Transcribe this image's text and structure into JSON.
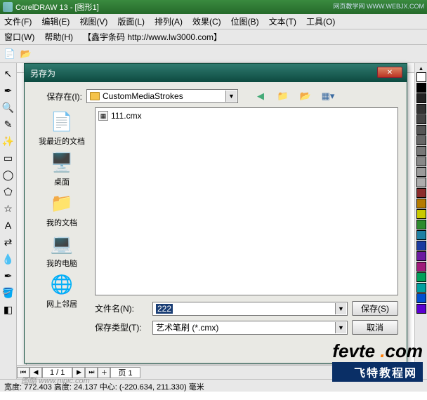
{
  "titlebar": {
    "text": "CorelDRAW 13 - [图形1]",
    "watermark": "网页教学网  WWW.WEBJX.COM"
  },
  "menus": {
    "row1": [
      "文件(F)",
      "编辑(E)",
      "视图(V)",
      "版面(L)",
      "排列(A)",
      "效果(C)",
      "位图(B)",
      "文本(T)",
      "工具(O)"
    ],
    "row2": [
      "窗口(W)",
      "帮助(H)",
      "【鑫宇条码 http://www.lw3000.com】"
    ]
  },
  "dialog": {
    "title": "另存为",
    "save_in_label": "保存在(I):",
    "save_in_value": "CustomMediaStrokes",
    "places": [
      {
        "icon": "📄",
        "label": "我最近的文档"
      },
      {
        "icon": "🖥️",
        "label": "桌面"
      },
      {
        "icon": "📁",
        "label": "我的文档"
      },
      {
        "icon": "💻",
        "label": "我的电脑"
      },
      {
        "icon": "🌐",
        "label": "网上邻居"
      }
    ],
    "file_item": "111.cmx",
    "filename_label": "文件名(N):",
    "filename_value": "222",
    "filetype_label": "保存类型(T):",
    "filetype_value": "艺术笔刷 (*.cmx)",
    "save_btn": "保存(S)",
    "cancel_btn": "取消"
  },
  "pager": {
    "pos": "1 / 1",
    "tab": "页 1"
  },
  "status": "宽度: 772.403 高度: 24.137 中心: (-220.634, 211.330) 毫米",
  "watermarks": {
    "fevte1": "fevte",
    "fevte_dot": " .",
    "fevte_com": "com",
    "fevte2": "飞特教程网",
    "nipic": "图酷 www.nipic.com"
  },
  "palette": [
    "#ffffff",
    "#000000",
    "#222222",
    "#333333",
    "#444444",
    "#555555",
    "#666666",
    "#777777",
    "#888888",
    "#9a9a9a",
    "#adadad",
    "#8b2c2c",
    "#b57b00",
    "#c9c900",
    "#2e8b2e",
    "#1e7fa3",
    "#1a3aa0",
    "#6a1aa0",
    "#a01a7a",
    "#00a05a",
    "#00a0a0",
    "#0050d0",
    "#5a00d0"
  ]
}
